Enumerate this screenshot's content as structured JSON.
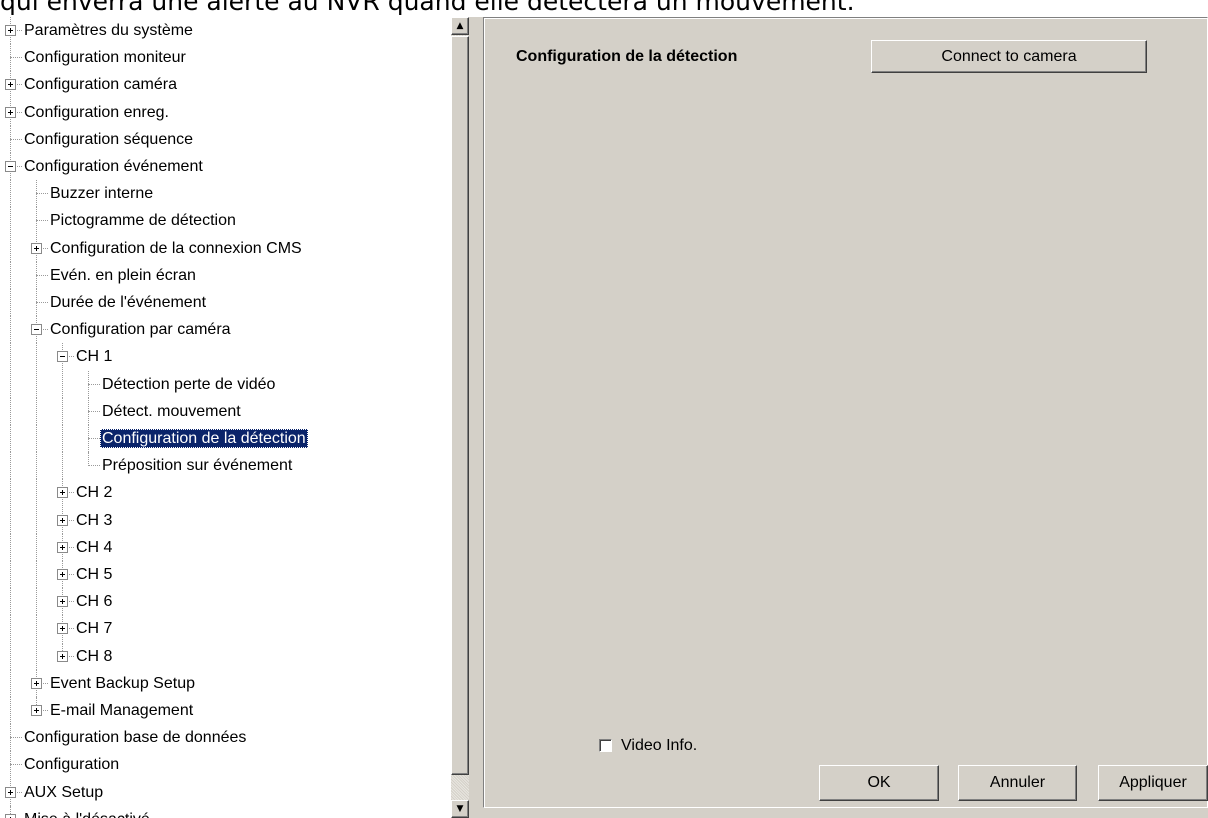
{
  "caption": "qui enverra une alerte au NVR quand elle détectera un mouvement.",
  "tree": [
    {
      "label": "Paramètres du système",
      "level": 0,
      "expander": "plus"
    },
    {
      "label": "Configuration moniteur",
      "level": 0,
      "expander": "none"
    },
    {
      "label": "Configuration caméra",
      "level": 0,
      "expander": "plus"
    },
    {
      "label": "Configuration enreg.",
      "level": 0,
      "expander": "plus"
    },
    {
      "label": "Configuration séquence",
      "level": 0,
      "expander": "none"
    },
    {
      "label": "Configuration événement",
      "level": 0,
      "expander": "minus"
    },
    {
      "label": "Buzzer interne",
      "level": 1,
      "expander": "none"
    },
    {
      "label": "Pictogramme de détection",
      "level": 1,
      "expander": "none"
    },
    {
      "label": "Configuration de la connexion CMS",
      "level": 1,
      "expander": "plus"
    },
    {
      "label": "Evén. en plein écran",
      "level": 1,
      "expander": "none"
    },
    {
      "label": "Durée de l'événement",
      "level": 1,
      "expander": "none"
    },
    {
      "label": "Configuration par caméra",
      "level": 1,
      "expander": "minus"
    },
    {
      "label": "CH 1",
      "level": 2,
      "expander": "minus"
    },
    {
      "label": "Détection perte de vidéo",
      "level": 3,
      "expander": "none"
    },
    {
      "label": "Détect. mouvement",
      "level": 3,
      "expander": "none"
    },
    {
      "label": "Configuration de la détection",
      "level": 3,
      "expander": "none",
      "selected": true
    },
    {
      "label": "Préposition sur événement",
      "level": 3,
      "expander": "none"
    },
    {
      "label": "CH 2",
      "level": 2,
      "expander": "plus"
    },
    {
      "label": "CH 3",
      "level": 2,
      "expander": "plus"
    },
    {
      "label": "CH 4",
      "level": 2,
      "expander": "plus"
    },
    {
      "label": "CH 5",
      "level": 2,
      "expander": "plus"
    },
    {
      "label": "CH 6",
      "level": 2,
      "expander": "plus"
    },
    {
      "label": "CH 7",
      "level": 2,
      "expander": "plus"
    },
    {
      "label": "CH 8",
      "level": 2,
      "expander": "plus"
    },
    {
      "label": "Event Backup Setup",
      "level": 1,
      "expander": "plus"
    },
    {
      "label": "E-mail Management",
      "level": 1,
      "expander": "plus"
    },
    {
      "label": "Configuration base de données",
      "level": 0,
      "expander": "none"
    },
    {
      "label": "Configuration",
      "level": 0,
      "expander": "none"
    },
    {
      "label": "AUX Setup",
      "level": 0,
      "expander": "plus"
    },
    {
      "label": "Mise à l'désactivé",
      "level": 0,
      "expander": "plus"
    }
  ],
  "scrollbar": {
    "up_icon": "arrow-up-icon",
    "down_icon": "arrow-down-icon"
  },
  "panel": {
    "title": "Configuration de la détection",
    "connect_button": "Connect to camera",
    "video_info_label": "Video Info.",
    "video_info_checked": false,
    "ok_button": "OK",
    "cancel_button": "Annuler",
    "apply_button": "Appliquer"
  },
  "colors": {
    "selection": "#0a246a",
    "face": "#d4d0c8"
  }
}
